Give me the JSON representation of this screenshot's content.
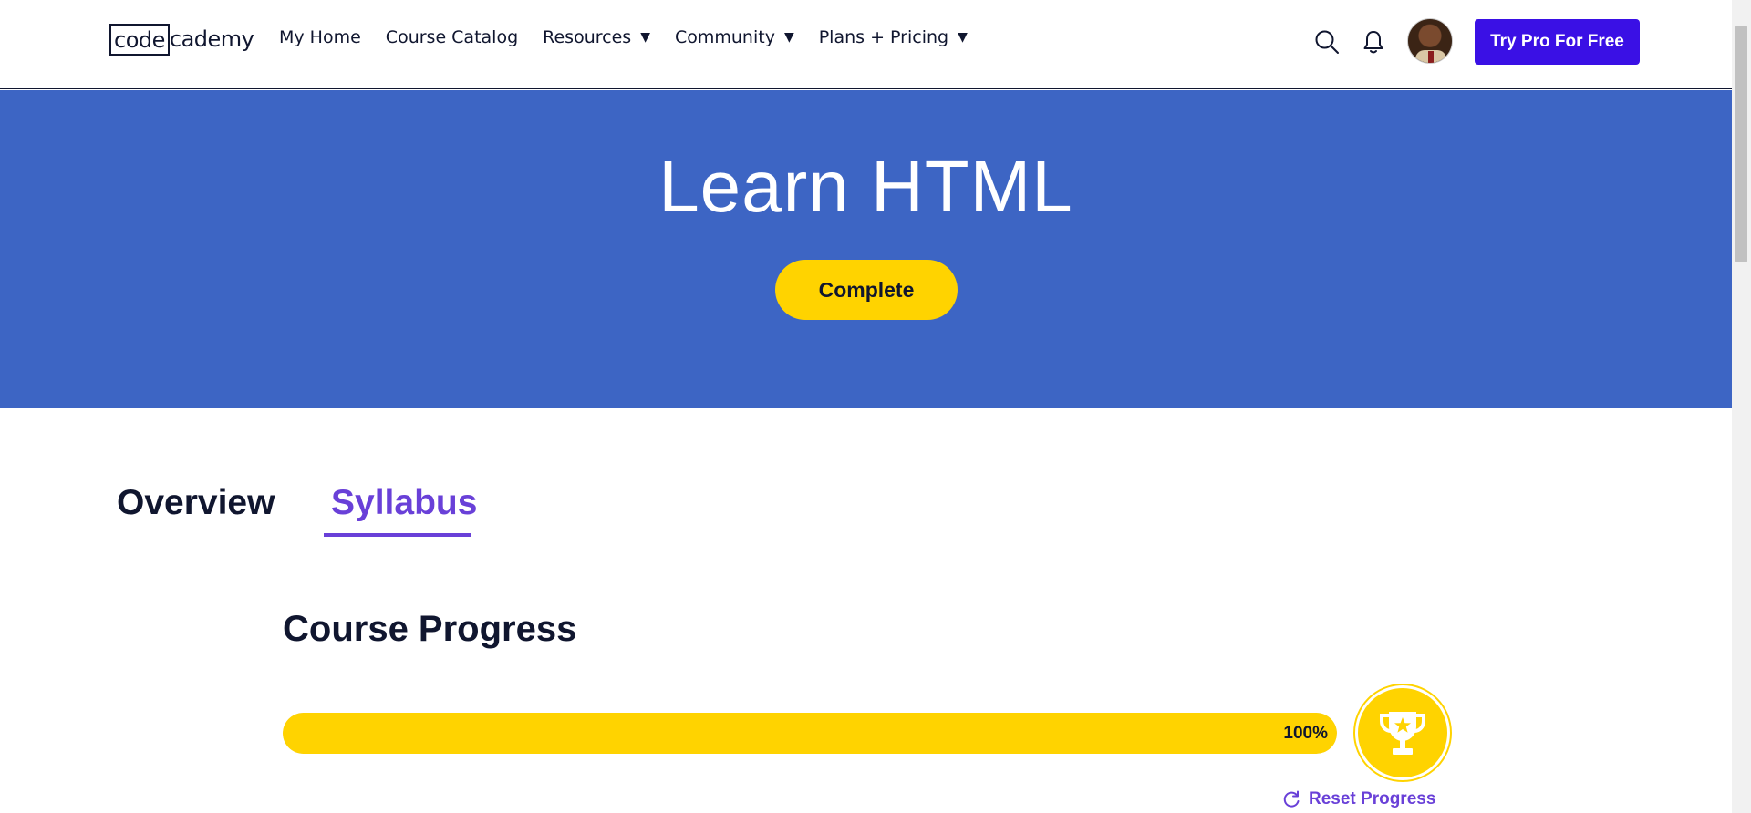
{
  "nav": {
    "logo_box": "code",
    "logo_rest": "cademy",
    "links": [
      {
        "label": "My Home",
        "has_caret": false
      },
      {
        "label": "Course Catalog",
        "has_caret": false
      },
      {
        "label": "Resources",
        "has_caret": true
      },
      {
        "label": "Community",
        "has_caret": true
      },
      {
        "label": "Plans + Pricing",
        "has_caret": true
      }
    ],
    "caret": "▼",
    "icons": [
      "search-icon",
      "bell-icon"
    ],
    "cta_label": "Try Pro For Free",
    "cta_color": "#3a10e5"
  },
  "hero": {
    "title": "Learn HTML",
    "status_button": "Complete",
    "background": "#3d65c4",
    "button_color": "#ffd300"
  },
  "tabs": {
    "items": [
      "Overview",
      "Syllabus"
    ],
    "active": "Syllabus",
    "active_color": "#6940d8"
  },
  "progress": {
    "title": "Course Progress",
    "percent": 100,
    "percent_label": "100%",
    "reset_label": "Reset Progress",
    "badge_icon": "trophy-icon",
    "fill_color": "#ffd300"
  }
}
